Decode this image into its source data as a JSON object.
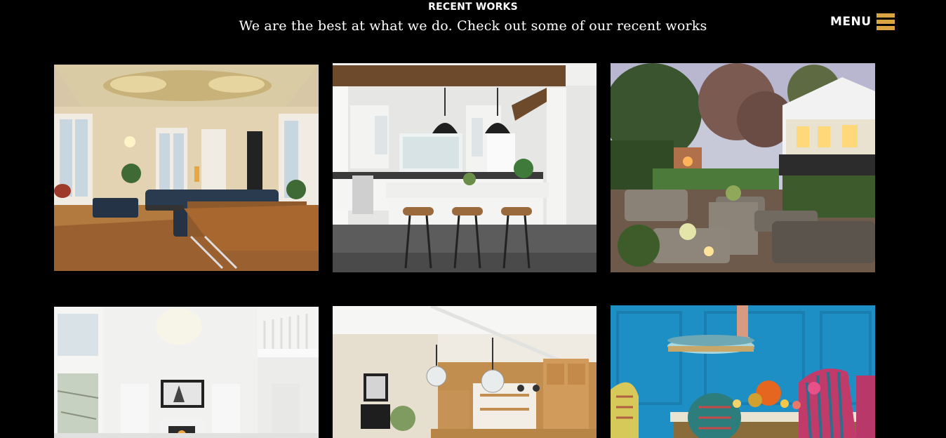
{
  "header": {
    "eyebrow": "RECENT WORKS",
    "subtitle": "We are the best at what we do. Check out some of our recent works"
  },
  "menu": {
    "label": "MENU",
    "icon": "hamburger-icon",
    "accent": "#d9a441"
  },
  "works": [
    {
      "icon": "living-room-photo"
    },
    {
      "icon": "kitchen-island-photo"
    },
    {
      "icon": "outdoor-patio-photo"
    },
    {
      "icon": "white-living-room-photo"
    },
    {
      "icon": "wood-kitchen-photo"
    },
    {
      "icon": "blue-dining-room-photo"
    }
  ],
  "colors": {
    "background": "#000000",
    "text": "#ffffff"
  }
}
